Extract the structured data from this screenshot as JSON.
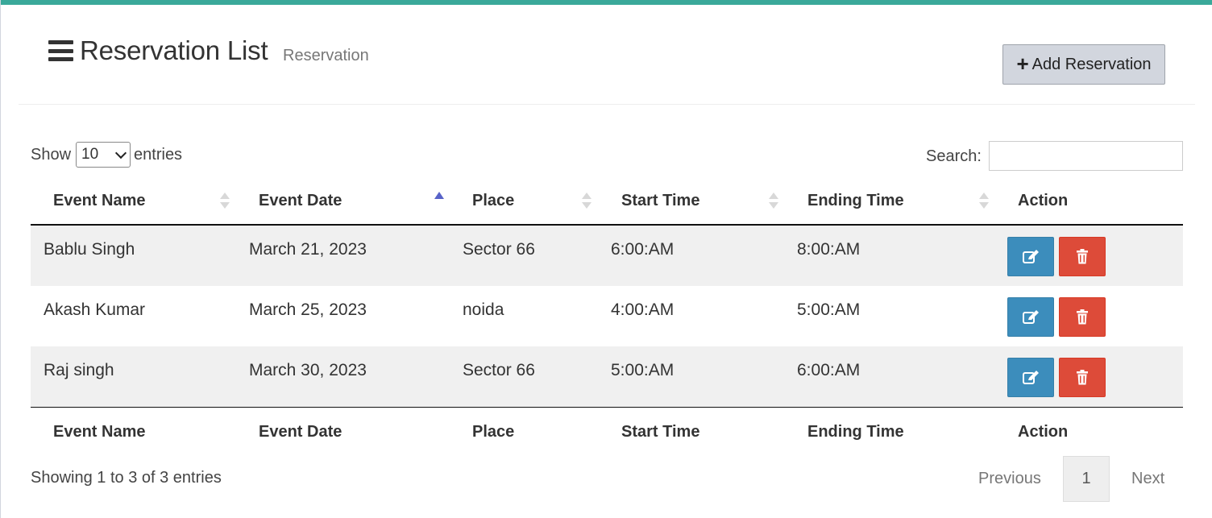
{
  "header": {
    "title": "Reservation List",
    "subtitle": "Reservation",
    "add_button_label": "Add Reservation",
    "menu_icon": "bars-icon",
    "add_icon": "plus-icon"
  },
  "controls": {
    "show_label": "Show",
    "entries_label": "entries",
    "page_length": "10",
    "search_label": "Search:",
    "search_value": ""
  },
  "table": {
    "columns": [
      "Event Name",
      "Event Date",
      "Place",
      "Start Time",
      "Ending Time",
      "Action"
    ],
    "sorted_column": "Event Date",
    "sort_direction": "ascending",
    "rows": [
      {
        "event_name": "Bablu Singh",
        "event_date": "March 21, 2023",
        "place": "Sector 66",
        "start_time": "6:00:AM",
        "ending_time": "8:00:AM"
      },
      {
        "event_name": "Akash Kumar",
        "event_date": "March 25, 2023",
        "place": "noida",
        "start_time": "4:00:AM",
        "ending_time": "5:00:AM"
      },
      {
        "event_name": "Raj singh",
        "event_date": "March 30, 2023",
        "place": "Sector 66",
        "start_time": "5:00:AM",
        "ending_time": "6:00:AM"
      }
    ],
    "action_icons": [
      "edit-icon",
      "trash-icon"
    ]
  },
  "footer": {
    "info": "Showing 1 to 3 of 3 entries",
    "previous_label": "Previous",
    "current_page": "1",
    "next_label": "Next"
  },
  "colors": {
    "accent_top": "#3aa99a",
    "edit_button": "#3c8dbc",
    "delete_button": "#dd4b39",
    "sort_active": "#5863c8"
  }
}
